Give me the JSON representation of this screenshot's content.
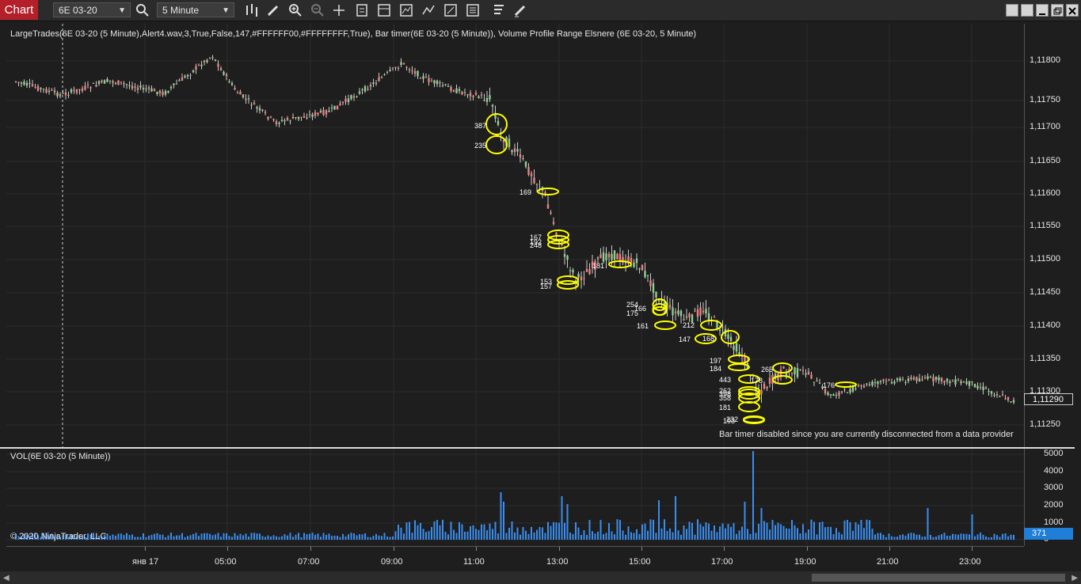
{
  "toolbar": {
    "chart_tab": "Chart",
    "instrument": "6E 03-20",
    "interval": "5 Minute"
  },
  "price_panel": {
    "indicator_label": "LargeTrades(6E 03-20 (5 Minute),Alert4.wav,3,True,False,147,#FFFFFF00,#FFFFFFFF,True), Bar timer(6E 03-20 (5 Minute)), Volume Profile Range Elsnere (6E 03-20, 5 Minute)",
    "bar_timer_message": "Bar timer disabled since you are currently disconnected from a data provider",
    "price_ticks": [
      "1,11800",
      "1,11750",
      "1,11700",
      "1,11650",
      "1,11600",
      "1,11550",
      "1,11500",
      "1,11450",
      "1,11400",
      "1,11350",
      "1,11300",
      "1,11250"
    ],
    "last_price": "1,11290"
  },
  "volume_panel": {
    "label": "VOL(6E 03-20 (5 Minute))",
    "copyright": "© 2020 NinjaTrader, LLC",
    "volume_ticks": [
      "5000",
      "4000",
      "3000",
      "2000",
      "1000",
      "0"
    ],
    "last_volume": "371"
  },
  "time_axis": {
    "ticks": [
      "янв 17",
      "05:00",
      "07:00",
      "09:00",
      "11:00",
      "13:00",
      "15:00",
      "17:00",
      "19:00",
      "21:00",
      "23:00"
    ]
  },
  "large_trades": [
    {
      "label": "387"
    },
    {
      "label": "235"
    },
    {
      "label": "169"
    },
    {
      "label": "167"
    },
    {
      "label": "192"
    },
    {
      "label": "248"
    },
    {
      "label": "153"
    },
    {
      "label": "157"
    },
    {
      "label": "181"
    },
    {
      "label": "254"
    },
    {
      "label": "166"
    },
    {
      "label": "175"
    },
    {
      "label": "161"
    },
    {
      "label": "212"
    },
    {
      "label": "147"
    },
    {
      "label": "168"
    },
    {
      "label": "197"
    },
    {
      "label": "184"
    },
    {
      "label": "443"
    },
    {
      "label": "262"
    },
    {
      "label": "398"
    },
    {
      "label": "358"
    },
    {
      "label": "181"
    },
    {
      "label": "232"
    },
    {
      "label": "193"
    },
    {
      "label": "265"
    },
    {
      "label": "178"
    },
    {
      "label": "176"
    }
  ],
  "colors": {
    "up_candle": "#8fd08f",
    "down_candle": "#f08080",
    "large_trade": "#ffff00",
    "volume": "#3a8ef0",
    "chart_tab": "#b3202a",
    "last_price_badge": "#1e1e1e",
    "last_volume_badge": "#1f7ed8"
  }
}
